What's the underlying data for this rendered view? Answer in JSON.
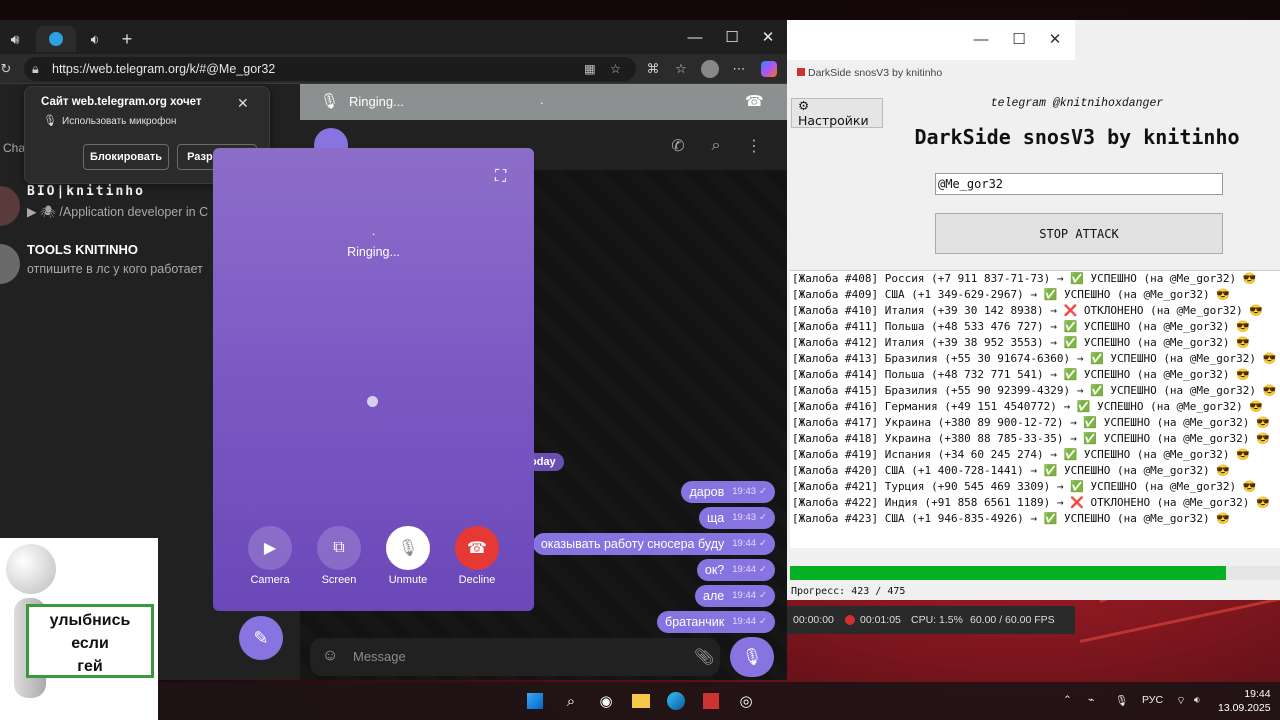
{
  "browser": {
    "url": "https://web.telegram.org/k/#@Me_gor32",
    "icons": [
      "speaker-icon",
      "telegram-icon",
      "new-tab-icon",
      "copilot-icon"
    ]
  },
  "permission": {
    "title": "Сайт web.telegram.org хочет",
    "subtitle": "Использовать микрофон",
    "block_label": "Блокировать",
    "allow_label": "Разрешить"
  },
  "sidebar": {
    "chats_label": "Cha",
    "chats": [
      {
        "name": "BIO|knitinho",
        "preview": "▶ 🕷 /Application developer in C"
      },
      {
        "name": "TOOLS KNITINHO",
        "preview": "отпишите в лс у кого работает"
      }
    ]
  },
  "call_bar": {
    "status": "Ringing...",
    "dot": "."
  },
  "call": {
    "dot": ".",
    "status": "Ringing...",
    "buttons": [
      {
        "label": "Camera"
      },
      {
        "label": "Screen"
      },
      {
        "label": "Unmute"
      },
      {
        "label": "Decline"
      }
    ]
  },
  "chat": {
    "date_chip": "oday",
    "messages": [
      {
        "text": "даров",
        "time": "19:43"
      },
      {
        "text": "ща",
        "time": "19:43"
      },
      {
        "text": "оказывать работу сносера буду",
        "time": "19:44"
      },
      {
        "text": "ок?",
        "time": "19:44"
      },
      {
        "text": "але",
        "time": "19:44"
      },
      {
        "text": "братанчик",
        "time": "19:44"
      }
    ],
    "composer_placeholder": "Message"
  },
  "app": {
    "window_title": "DarkSide snosV3 by knitinho",
    "settings_label": "⚙ Настройки",
    "subtitle": "telegram @knitnihoxdanger",
    "heading": "DarkSide snosV3 by knitinho",
    "target_value": "@Me_gor32",
    "stop_label": "STOP ATTACK",
    "log": [
      "[Жалоба #408] Россия (+7 911 837-71-73) → ✅ УСПЕШНО (на @Me_gor32) 😎",
      "[Жалоба #409] США (+1 349-629-2967) → ✅ УСПЕШНО (на @Me_gor32) 😎",
      "[Жалоба #410] Италия (+39 30 142 8938) → ❌ ОТКЛОНЕНО (на @Me_gor32) 😎",
      "[Жалоба #411] Польша (+48 533 476 727) → ✅ УСПЕШНО (на @Me_gor32) 😎",
      "[Жалоба #412] Италия (+39 38 952 3553) → ✅ УСПЕШНО (на @Me_gor32) 😎",
      "[Жалоба #413] Бразилия (+55 30 91674-6360) → ✅ УСПЕШНО (на @Me_gor32) 😎",
      "[Жалоба #414] Польша (+48 732 771 541) → ✅ УСПЕШНО (на @Me_gor32) 😎",
      "[Жалоба #415] Бразилия (+55 90 92399-4329) → ✅ УСПЕШНО (на @Me_gor32) 😎",
      "[Жалоба #416] Германия (+49 151 4540772) → ✅ УСПЕШНО (на @Me_gor32) 😎",
      "[Жалоба #417] Украина (+380 89 900-12-72) → ✅ УСПЕШНО (на @Me_gor32) 😎",
      "[Жалоба #418] Украина (+380 88 785-33-35) → ✅ УСПЕШНО (на @Me_gor32) 😎",
      "[Жалоба #419] Испания (+34 60 245 274) → ✅ УСПЕШНО (на @Me_gor32) 😎",
      "[Жалоба #420] США (+1 400-728-1441) → ✅ УСПЕШНО (на @Me_gor32) 😎",
      "[Жалоба #421] Турция (+90 545 469 3309) → ✅ УСПЕШНО (на @Me_gor32) 😎",
      "[Жалоба #422] Индия (+91 858 6561 1189) → ❌ ОТКЛОНЕНО (на @Me_gor32) 😎",
      "[Жалоба #423] США (+1 946-835-4926) → ✅ УСПЕШНО (на @Me_gor32) 😎"
    ],
    "progress_text": "Прогресс: 423 / 475",
    "progress_fraction": 0.8905
  },
  "stats": {
    "time": "00:00:00",
    "rec": "00:01:05",
    "cpu": "CPU: 1.5%",
    "fps": "60.00 / 60.00 FPS"
  },
  "meme": {
    "lines": [
      "улыбнись",
      "если",
      "гей"
    ]
  },
  "taskbar": {
    "lang": "РУС",
    "time": "19:44",
    "date": "13.09.2025"
  },
  "colors": {
    "accent": "#8774e1",
    "decline": "#e53935",
    "progress": "#06b025"
  }
}
